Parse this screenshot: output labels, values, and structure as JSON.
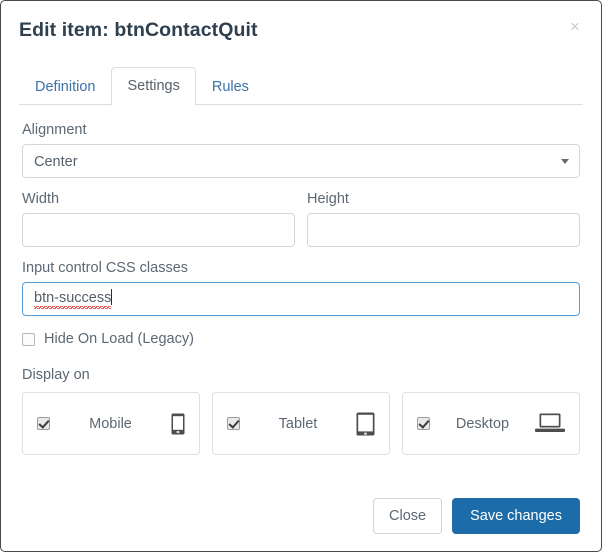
{
  "modal": {
    "title": "Edit item: btnContactQuit",
    "close_icon": "close-x-icon"
  },
  "tabs": [
    {
      "label": "Definition",
      "active": false
    },
    {
      "label": "Settings",
      "active": true
    },
    {
      "label": "Rules",
      "active": false
    }
  ],
  "form": {
    "alignment": {
      "label": "Alignment",
      "value": "Center",
      "caret_icon": "chevron-down-icon",
      "options": [
        "Center"
      ]
    },
    "width": {
      "label": "Width",
      "value": "",
      "placeholder": ""
    },
    "height": {
      "label": "Height",
      "value": "",
      "placeholder": ""
    },
    "css_classes": {
      "label": "Input control CSS classes",
      "value": "btn-success",
      "placeholder": "",
      "focused": true,
      "spellcheck_flagged": true
    },
    "hide_on_load": {
      "label": "Hide On Load (Legacy)",
      "checked": false
    },
    "display_on": {
      "label": "Display on",
      "devices": [
        {
          "label": "Mobile",
          "checked": true,
          "icon": "mobile-phone-icon"
        },
        {
          "label": "Tablet",
          "checked": true,
          "icon": "tablet-icon"
        },
        {
          "label": "Desktop",
          "checked": true,
          "icon": "laptop-icon"
        }
      ]
    }
  },
  "footer": {
    "close_label": "Close",
    "save_label": "Save changes"
  },
  "colors": {
    "primary": "#1b6ca8",
    "tab_link": "#3a73a8",
    "title": "#2e3f4f",
    "label": "#5c6873",
    "focus_border": "#5b9ad5",
    "spellcheck": "#e03030"
  }
}
